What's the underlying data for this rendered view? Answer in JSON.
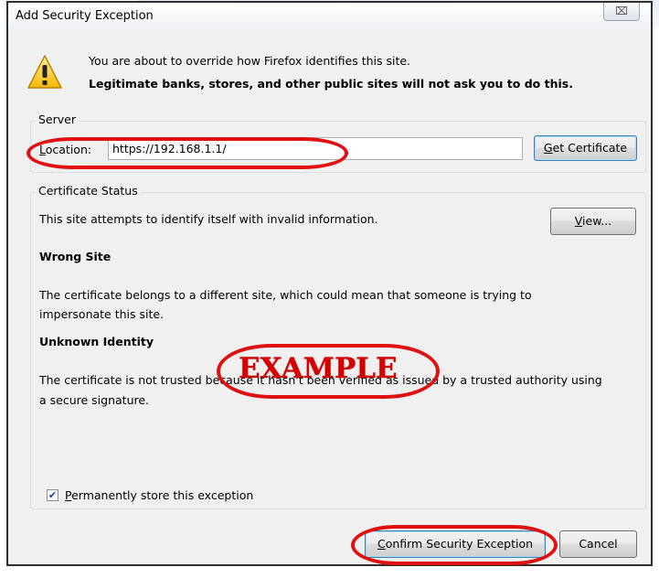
{
  "dialog": {
    "title": "Add Security Exception",
    "close_icon": "close-icon",
    "close_glyph": "⌧"
  },
  "intro": {
    "icon": "warning-icon",
    "line1": "You are about to override how Firefox identifies this site.",
    "line2": "Legitimate banks, stores, and other public sites will not ask you to do this."
  },
  "server": {
    "legend": "Server",
    "location_label_underlined": "L",
    "location_label_rest": "ocation:",
    "location_value": "https://192.168.1.1/",
    "get_cert_underlined": "G",
    "get_cert_rest": "et Certificate"
  },
  "cert_status": {
    "legend": "Certificate Status",
    "summary": "This site attempts to identify itself with invalid information.",
    "view_underlined": "V",
    "view_rest": "iew...",
    "wrong_site_heading": "Wrong Site",
    "wrong_site_line1": "The certificate belongs to a different site, which could mean that someone is trying to",
    "wrong_site_line2": "impersonate this site.",
    "unknown_heading": "Unknown Identity",
    "unknown_line1": "The certificate is not trusted because it hasn't been verified as issued by a trusted authority using",
    "unknown_line2": "a secure signature."
  },
  "permanent": {
    "checked": true,
    "check_glyph": "✔",
    "label_underlined": "P",
    "label_rest": "ermanently store this exception"
  },
  "buttons": {
    "confirm_underlined": "C",
    "confirm_rest": "onfirm Security Exception",
    "cancel": "Cancel"
  },
  "watermark": {
    "text": "EXAMPLE",
    "color": "#d40000"
  },
  "annotation_color": "#e01010"
}
